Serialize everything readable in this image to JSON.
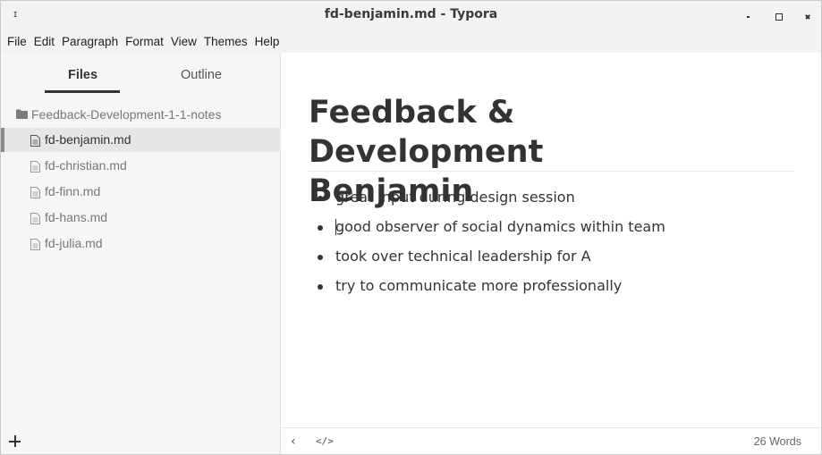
{
  "window": {
    "title": "fd-benjamin.md - Typora",
    "app_glyph": "ɪ"
  },
  "menu": [
    "File",
    "Edit",
    "Paragraph",
    "Format",
    "View",
    "Themes",
    "Help"
  ],
  "sidebar": {
    "tabs": {
      "files": "Files",
      "outline": "Outline",
      "active": "files"
    },
    "folder": {
      "label": "Feedback-Development-1-1-notes",
      "icon": "folder-icon"
    },
    "files": [
      {
        "label": "fd-benjamin.md",
        "active": true
      },
      {
        "label": "fd-christian.md",
        "active": false
      },
      {
        "label": "fd-finn.md",
        "active": false
      },
      {
        "label": "fd-hans.md",
        "active": false
      },
      {
        "label": "fd-julia.md",
        "active": false
      }
    ],
    "add_icon": "plus-icon"
  },
  "editor": {
    "title_line1": "Feedback & Development",
    "title_line2": "Benjamin",
    "bullets": [
      "great input during design session",
      "good observer of social dynamics within team",
      "took over technical leadership for A",
      "try to communicate more professionally"
    ]
  },
  "status": {
    "back_icon": "chevron-left-icon",
    "source_icon": "code-icon",
    "source_label": "</>",
    "back_label": "‹",
    "word_count": "26 Words"
  }
}
